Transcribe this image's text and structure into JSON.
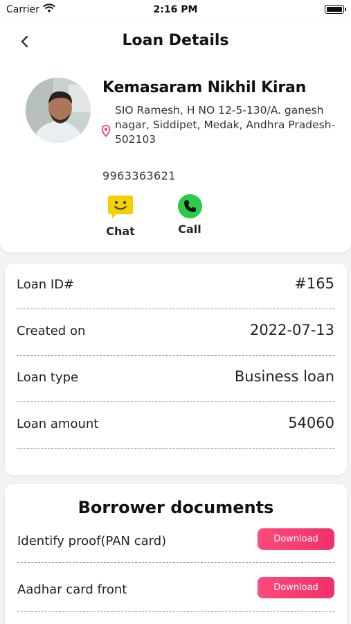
{
  "status_bar": {
    "carrier": "Carrier",
    "time": "2:16 PM"
  },
  "header": {
    "title": "Loan Details"
  },
  "borrower": {
    "name": "Kemasaram Nikhil Kiran",
    "address": "SIO Ramesh, H NO 12-5-130/A. ganesh nagar, Siddipet, Medak, Andhra Pradesh-\n502103",
    "phone": "9963363621"
  },
  "actions": {
    "chat_label": "Chat",
    "call_label": "Call"
  },
  "loan_info": [
    {
      "key": "Loan ID#",
      "value": "#165"
    },
    {
      "key": "Created on",
      "value": "2022-07-13"
    },
    {
      "key": "Loan type",
      "value": "Business loan"
    },
    {
      "key": "Loan amount",
      "value": "54060"
    }
  ],
  "documents": {
    "title": "Borrower documents",
    "items": [
      {
        "label": "Identify proof(PAN card)",
        "button": "Download"
      },
      {
        "label": "Aadhar card front",
        "button": "Download"
      }
    ]
  },
  "colors": {
    "download_button": "#f5396f",
    "call_green": "#2cc94a",
    "chat_yellow": "#f5d000"
  },
  "icons": {
    "back": "chevron-left-icon",
    "location": "location-pin-icon",
    "chat": "smiley-chat-icon",
    "call": "phone-icon"
  }
}
